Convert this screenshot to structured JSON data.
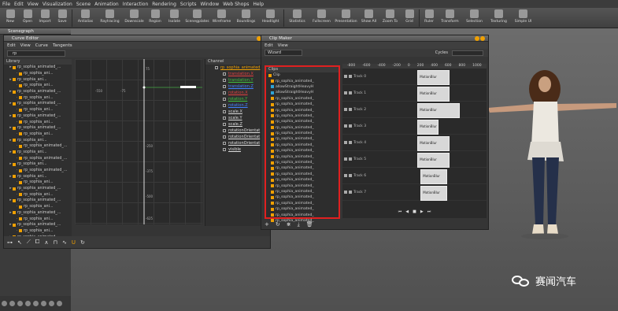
{
  "menu": [
    "File",
    "Edit",
    "View",
    "Visualization",
    "Scene",
    "Animation",
    "Interaction",
    "Rendering",
    "Scripts",
    "Window",
    "Web Shops",
    "Help"
  ],
  "toolbar": [
    {
      "label": "New"
    },
    {
      "label": "Open"
    },
    {
      "label": "Import"
    },
    {
      "label": "Save"
    },
    {
      "label": "Antialias"
    },
    {
      "label": "Raytracing"
    },
    {
      "label": "Downscale"
    },
    {
      "label": "Region"
    },
    {
      "label": "Isolate"
    },
    {
      "label": "Scenegplates"
    },
    {
      "label": "Wireframe"
    },
    {
      "label": "Boundings"
    },
    {
      "label": "Headlight"
    },
    {
      "label": "Statistics"
    },
    {
      "label": "Fullscreen"
    },
    {
      "label": "Presentation"
    },
    {
      "label": "Show All"
    },
    {
      "label": "Zoom To"
    },
    {
      "label": "Grid"
    },
    {
      "label": "Ruler"
    },
    {
      "label": "Transform"
    },
    {
      "label": "Selection"
    },
    {
      "label": "Texturing"
    },
    {
      "label": "Simple UI"
    }
  ],
  "scenegraph": {
    "title": "Scenegraph"
  },
  "curve_editor": {
    "title": "Curve Editor",
    "menu": [
      "Edit",
      "View",
      "Curve",
      "Tangents"
    ],
    "search_value": "rp",
    "library_header": "Library",
    "library_items": [
      "rp_sophia_animated_...",
      "rp_sophia_ani...",
      "rp_sophia_ani...",
      "rp_sophia_ani...",
      "rp_sophia_animated_...",
      "rp_sophia_ani...",
      "rp_sophia_animated_...",
      "rp_sophia_ani...",
      "rp_sophia_animated_...",
      "rp_sophia_ani...",
      "rp_sophia_animated_...",
      "rp_sophia_ani...",
      "rp_sophia_ani...",
      "rp_sophia_animated_...",
      "rp_sophia_ani...",
      "rp_sophia_animated_...",
      "rp_sophia_ani...",
      "rp_sophia_animated_...",
      "rp_sophia_ani...",
      "rp_sophia_ani...",
      "rp_sophia_animated_...",
      "rp_sophia_ani...",
      "rp_sophia_animated_...",
      "rp_sophia_ani...",
      "rp_sophia_animated_...",
      "rp_sophia_ani...",
      "rp_sophia_animated_...",
      "rp_sophia_ani...",
      "rp_sophia_animated_..."
    ],
    "channel_header": "Channel",
    "channel_root": "rp_sophia_animated",
    "channels": [
      {
        "name": "translation.X",
        "color": "#e04040"
      },
      {
        "name": "translation.Y",
        "color": "#40c040"
      },
      {
        "name": "translation.Z",
        "color": "#4080ff"
      },
      {
        "name": "rotation.X",
        "color": "#e04040"
      },
      {
        "name": "rotation.Y",
        "color": "#40c040"
      },
      {
        "name": "rotation.Z",
        "color": "#4080ff"
      },
      {
        "name": "scale.X",
        "color": "#dddddd"
      },
      {
        "name": "scale.Y",
        "color": "#dddddd"
      },
      {
        "name": "scale.Z",
        "color": "#dddddd"
      },
      {
        "name": "rotationOrientat",
        "color": "#dddddd"
      },
      {
        "name": "rotationOrientat",
        "color": "#dddddd"
      },
      {
        "name": "rotationOrientat",
        "color": "#dddddd"
      },
      {
        "name": "visible",
        "color": "#dddddd"
      }
    ],
    "graph_ticks_y": [
      "75",
      "-250",
      "-375",
      "-500",
      "-625"
    ],
    "graph_ticks_x": [
      "-550",
      "-75"
    ]
  },
  "clip_maker": {
    "title": "Clip Maker",
    "menu": [
      "Edit",
      "View"
    ],
    "wizard": "Wizard",
    "cycles_label": "Cycles",
    "clips_header": "Clips",
    "clips": [
      {
        "label": "Clip",
        "type": "folder"
      },
      {
        "label": "rp_sophia_animated_",
        "type": "anim"
      },
      {
        "label": "allowStraightHeavyH",
        "type": "glyph"
      },
      {
        "label": "allowStraightHeavyH",
        "type": "glyph"
      },
      {
        "label": "rp_sophia_animated_",
        "type": "anim"
      },
      {
        "label": "rp_sophia_animated_",
        "type": "anim"
      },
      {
        "label": "rp_sophia_animated_",
        "type": "anim"
      },
      {
        "label": "rp_sophia_animated_",
        "type": "anim"
      },
      {
        "label": "rp_sophia_animated_",
        "type": "anim"
      },
      {
        "label": "rp_sophia_animated_",
        "type": "anim"
      },
      {
        "label": "rp_sophia_animated_",
        "type": "anim"
      },
      {
        "label": "rp_sophia_animated_",
        "type": "anim"
      },
      {
        "label": "rp_sophia_animated_",
        "type": "anim"
      },
      {
        "label": "rp_sophia_animated_",
        "type": "anim"
      },
      {
        "label": "rp_sophia_animated_",
        "type": "anim"
      },
      {
        "label": "rp_sophia_animated_",
        "type": "anim"
      },
      {
        "label": "rp_sophia_animated_",
        "type": "anim"
      },
      {
        "label": "rp_sophia_animated_",
        "type": "anim"
      },
      {
        "label": "rp_sophia_animated_",
        "type": "anim"
      },
      {
        "label": "rp_sophia_animated_",
        "type": "anim"
      },
      {
        "label": "rp_sophia_animated_",
        "type": "anim"
      },
      {
        "label": "rp_sophia_animated_",
        "type": "anim"
      },
      {
        "label": "rp_sophia_animated_",
        "type": "anim"
      },
      {
        "label": "rp_sophia_animated_",
        "type": "anim"
      },
      {
        "label": "rp_sophia_animated_",
        "type": "anim"
      },
      {
        "label": "rp_sophia_animated_",
        "type": "anim"
      }
    ],
    "ruler": [
      "-800",
      "-600",
      "-400",
      "-200",
      "0",
      "200",
      "400",
      "600",
      "800",
      "1000"
    ],
    "tracks": [
      {
        "label": "Track 0",
        "block": "MotionBlur",
        "start": 0.35,
        "width": 0.3
      },
      {
        "label": "Track 1",
        "block": "MotionBlur",
        "start": 0.35,
        "width": 0.3
      },
      {
        "label": "Track 2",
        "block": "MotionBlur",
        "start": 0.35,
        "width": 0.4
      },
      {
        "label": "Track 3",
        "block": "MotionBlur",
        "start": 0.35,
        "width": 0.2
      },
      {
        "label": "Track 4",
        "block": "MotionBlur",
        "start": 0.35,
        "width": 0.3
      },
      {
        "label": "Track 5",
        "block": "MotionBlur",
        "start": 0.35,
        "width": 0.3
      },
      {
        "label": "Track 6",
        "block": "MotionBlur",
        "start": 0.38,
        "width": 0.25
      },
      {
        "label": "Track 7",
        "block": "MotionBlur",
        "start": 0.38,
        "width": 0.25
      }
    ]
  },
  "watermark": {
    "text": "赛闻汽车"
  },
  "colors": {
    "accent": "#f0a000",
    "highlight_border": "#e02020"
  }
}
